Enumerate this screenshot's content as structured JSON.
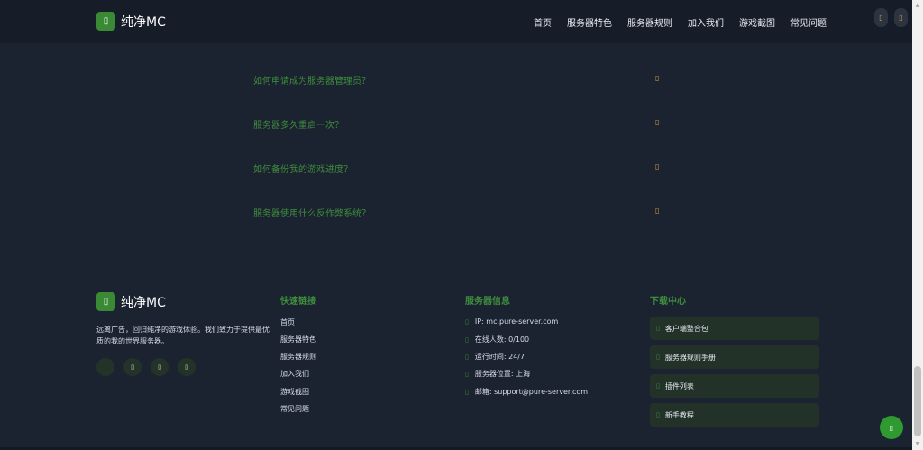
{
  "header": {
    "logo_icon": "cube-icon",
    "logo_glyph": "▯",
    "site_name": "纯净MC",
    "nav": [
      "首页",
      "服务器特色",
      "服务器规则",
      "加入我们",
      "游戏截图",
      "常见问题"
    ],
    "button_glyph": "▯"
  },
  "faq": {
    "toggle_glyph": "▯",
    "items": [
      "如何申请成为服务器管理员？",
      "服务器多久重启一次？",
      "如何备份我的游戏进度？",
      "服务器使用什么反作弊系统？"
    ]
  },
  "footer": {
    "site_name": "纯净MC",
    "logo_glyph": "▯",
    "description": "远离广告，回归纯净的游戏体验。我们致力于提供最优质的我的世界服务器。",
    "social_glyph": "▯",
    "quick_links_title": "快速链接",
    "quick_links": [
      "首页",
      "服务器特色",
      "服务器规则",
      "加入我们",
      "游戏截图",
      "常见问题"
    ],
    "server_info_title": "服务器信息",
    "server_info": [
      "IP: mc.pure-server.com",
      "在线人数: 0/100",
      "运行时间: 24/7",
      "服务器位置: 上海",
      "邮箱: support@pure-server.com"
    ],
    "info_glyph": "▯",
    "download_title": "下载中心",
    "downloads": [
      "客户端整合包",
      "服务器规则手册",
      "插件列表",
      "新手教程"
    ],
    "download_glyph": "▯"
  },
  "back_to_top_glyph": "▯",
  "colors": {
    "background": "#1b2230",
    "accent_green": "#3f8d3d",
    "accent_orange": "#e6a23c"
  }
}
